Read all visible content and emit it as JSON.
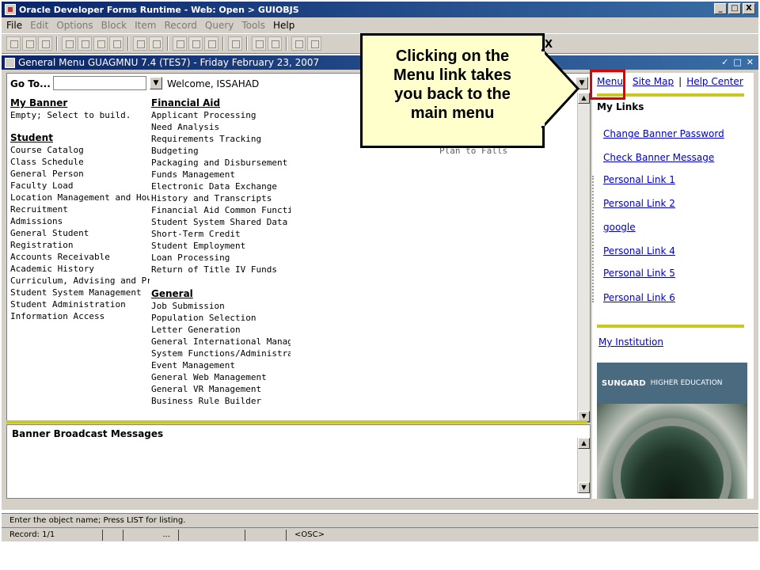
{
  "window": {
    "title": "Oracle Developer Forms Runtime - Web:  Open > GUIOBJS",
    "controls": [
      "_",
      "□",
      "X"
    ]
  },
  "menubar": [
    "File",
    "Edit",
    "Options",
    "Block",
    "Item",
    "Record",
    "Query",
    "Tools",
    "Help"
  ],
  "toolbar": {
    "close_mark": "X"
  },
  "form": {
    "title": "General Menu  GUAGMNU  7.4  (TES7) - Friday February 23, 2007",
    "goto_label": "Go To...",
    "goto_value": "",
    "welcome": "Welcome, ISSAHAD",
    "dropdown_arrow": "▼"
  },
  "columns": {
    "my_banner": {
      "header": "My Banner",
      "items": [
        "Empty; Select to build."
      ]
    },
    "student": {
      "header": "Student",
      "items": [
        "Course Catalog",
        "Class Schedule",
        "General Person",
        "Faculty Load",
        "Location Management and Housi",
        "Recruitment",
        "Admissions",
        "General Student",
        "Registration",
        "Accounts Receivable",
        "Academic History",
        "Curriculum, Advising and Progra",
        "Student System Management",
        "Student Administration",
        "Information Access"
      ]
    },
    "financial_aid": {
      "header": "Financial Aid",
      "items": [
        "Applicant Processing",
        "Need Analysis",
        "Requirements Tracking",
        "Budgeting",
        "Packaging and Disbursement",
        "Funds Management",
        "Electronic Data Exchange",
        "History and Transcripts",
        "Financial Aid Common Functions",
        "Student System Shared Data",
        "Short-Term Credit",
        "Student Employment",
        "Loan Processing",
        "Return of Title IV Funds"
      ]
    },
    "general": {
      "header": "General",
      "items": [
        "Job Submission",
        "Population Selection",
        "Letter Generation",
        "General International Manageme",
        "System Functions/Administration",
        "Event Management",
        "General Web Management",
        "General VR Management",
        "Business Rule Builder"
      ]
    },
    "partial_text": "Plan to Falls"
  },
  "broadcast": {
    "title": "Banner Broadcast Messages"
  },
  "right_panel": {
    "top_links": [
      "Menu",
      "Site Map",
      "Help Center"
    ],
    "separator": "|",
    "my_links_header": "My Links",
    "links": [
      "Change Banner Password",
      "Check Banner Message",
      "Personal Link 1",
      "Personal Link 2",
      "google",
      "Personal Link 4",
      "Personal Link 5",
      "Personal Link 6"
    ],
    "my_institution": "My Institution",
    "sungard_brand": "SUNGARD",
    "sungard_sub": "HIGHER EDUCATION"
  },
  "status": {
    "hint": "Enter the object name; Press LIST for listing.",
    "record": "Record: 1/1",
    "ellipsis": "...",
    "osc": "<OSC>"
  },
  "callout": {
    "lines": [
      "Clicking on the",
      "Menu link takes",
      "you back to the",
      "main menu"
    ]
  },
  "colors": {
    "rule": "#c8c81e",
    "link": "#0000cc",
    "titlebar": "#0a246a",
    "callout_bg": "#ffffcc",
    "highlight": "#e00000"
  }
}
